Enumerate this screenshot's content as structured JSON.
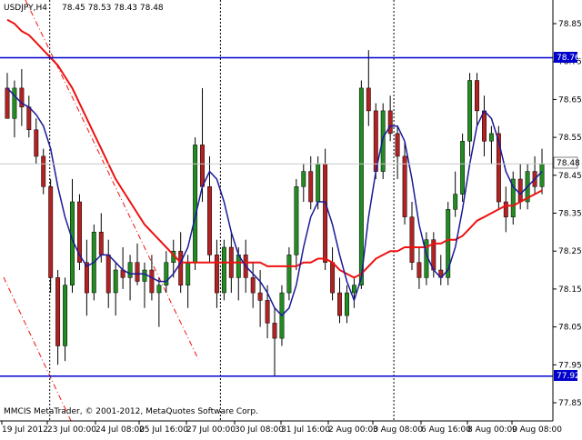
{
  "header": {
    "symbol": "USDJPY,H4",
    "ohlc": "78.45 78.53 78.43 78.48"
  },
  "footer": {
    "copyright": "MMCIS MetaTrader, © 2001-2012, MetaQuotes Software Corp."
  },
  "price_axis": {
    "ticks": [
      "78.85",
      "78.75",
      "78.65",
      "78.55",
      "78.45",
      "78.35",
      "78.25",
      "78.15",
      "78.05",
      "77.95",
      "77.85"
    ],
    "current_price_label": "78.48",
    "upper_line_label": "78.76",
    "lower_line_label": "77.92"
  },
  "time_axis": {
    "ticks": [
      "19 Jul 2012",
      "23 Jul 00:00",
      "24 Jul 08:00",
      "25 Jul 16:00",
      "27 Jul 00:00",
      "30 Jul 08:00",
      "31 Jul 16:00",
      "2 Aug 00:00",
      "3 Aug 08:00",
      "6 Aug 16:00",
      "8 Aug 00:00",
      "9 Aug 08:00"
    ]
  },
  "colors": {
    "bull": "#228b22",
    "bear": "#b22222",
    "wick": "#000000",
    "fast_ma": "#1a1a99",
    "slow_ma": "#ee1111",
    "level_line": "#0000cc",
    "level_label_bg": "#0000cc",
    "price_label_bg": "#ffffff"
  },
  "chart_data": {
    "type": "candlestick",
    "symbol": "USDJPY",
    "timeframe": "H4",
    "y_range": [
      77.8,
      78.9
    ],
    "horizontal_levels": [
      78.76,
      77.92
    ],
    "current_price": 78.48,
    "candles": [
      {
        "o": 78.68,
        "h": 78.72,
        "l": 78.6,
        "c": 78.6
      },
      {
        "o": 78.6,
        "h": 78.7,
        "l": 78.55,
        "c": 78.68
      },
      {
        "o": 78.68,
        "h": 78.73,
        "l": 78.58,
        "c": 78.63
      },
      {
        "o": 78.63,
        "h": 78.66,
        "l": 78.55,
        "c": 78.57
      },
      {
        "o": 78.57,
        "h": 78.6,
        "l": 78.48,
        "c": 78.5
      },
      {
        "o": 78.5,
        "h": 78.52,
        "l": 78.4,
        "c": 78.42
      },
      {
        "o": 78.42,
        "h": 78.44,
        "l": 78.14,
        "c": 78.18
      },
      {
        "o": 78.18,
        "h": 78.2,
        "l": 77.95,
        "c": 78.0
      },
      {
        "o": 78.0,
        "h": 78.18,
        "l": 77.96,
        "c": 78.16
      },
      {
        "o": 78.16,
        "h": 78.44,
        "l": 78.14,
        "c": 78.38
      },
      {
        "o": 78.38,
        "h": 78.4,
        "l": 78.2,
        "c": 78.22
      },
      {
        "o": 78.22,
        "h": 78.28,
        "l": 78.08,
        "c": 78.14
      },
      {
        "o": 78.14,
        "h": 78.32,
        "l": 78.12,
        "c": 78.3
      },
      {
        "o": 78.3,
        "h": 78.35,
        "l": 78.22,
        "c": 78.24
      },
      {
        "o": 78.24,
        "h": 78.28,
        "l": 78.1,
        "c": 78.14
      },
      {
        "o": 78.14,
        "h": 78.22,
        "l": 78.08,
        "c": 78.2
      },
      {
        "o": 78.2,
        "h": 78.26,
        "l": 78.15,
        "c": 78.18
      },
      {
        "o": 78.18,
        "h": 78.24,
        "l": 78.12,
        "c": 78.22
      },
      {
        "o": 78.22,
        "h": 78.27,
        "l": 78.16,
        "c": 78.17
      },
      {
        "o": 78.17,
        "h": 78.22,
        "l": 78.1,
        "c": 78.2
      },
      {
        "o": 78.2,
        "h": 78.24,
        "l": 78.12,
        "c": 78.14
      },
      {
        "o": 78.14,
        "h": 78.18,
        "l": 78.05,
        "c": 78.16
      },
      {
        "o": 78.16,
        "h": 78.25,
        "l": 78.14,
        "c": 78.22
      },
      {
        "o": 78.22,
        "h": 78.28,
        "l": 78.18,
        "c": 78.25
      },
      {
        "o": 78.25,
        "h": 78.3,
        "l": 78.14,
        "c": 78.16
      },
      {
        "o": 78.16,
        "h": 78.24,
        "l": 78.1,
        "c": 78.22
      },
      {
        "o": 78.22,
        "h": 78.55,
        "l": 78.2,
        "c": 78.53
      },
      {
        "o": 78.53,
        "h": 78.68,
        "l": 78.38,
        "c": 78.42
      },
      {
        "o": 78.42,
        "h": 78.5,
        "l": 78.22,
        "c": 78.24
      },
      {
        "o": 78.24,
        "h": 78.28,
        "l": 78.1,
        "c": 78.14
      },
      {
        "o": 78.14,
        "h": 78.28,
        "l": 78.12,
        "c": 78.26
      },
      {
        "o": 78.26,
        "h": 78.3,
        "l": 78.14,
        "c": 78.18
      },
      {
        "o": 78.18,
        "h": 78.26,
        "l": 78.12,
        "c": 78.24
      },
      {
        "o": 78.24,
        "h": 78.28,
        "l": 78.14,
        "c": 78.18
      },
      {
        "o": 78.18,
        "h": 78.22,
        "l": 78.1,
        "c": 78.14
      },
      {
        "o": 78.14,
        "h": 78.2,
        "l": 78.05,
        "c": 78.12
      },
      {
        "o": 78.12,
        "h": 78.16,
        "l": 78.02,
        "c": 78.06
      },
      {
        "o": 78.06,
        "h": 78.1,
        "l": 77.92,
        "c": 78.02
      },
      {
        "o": 78.02,
        "h": 78.16,
        "l": 78.0,
        "c": 78.14
      },
      {
        "o": 78.14,
        "h": 78.26,
        "l": 78.12,
        "c": 78.24
      },
      {
        "o": 78.24,
        "h": 78.44,
        "l": 78.2,
        "c": 78.42
      },
      {
        "o": 78.42,
        "h": 78.48,
        "l": 78.38,
        "c": 78.46
      },
      {
        "o": 78.46,
        "h": 78.5,
        "l": 78.36,
        "c": 78.38
      },
      {
        "o": 78.38,
        "h": 78.5,
        "l": 78.36,
        "c": 78.48
      },
      {
        "o": 78.48,
        "h": 78.52,
        "l": 78.2,
        "c": 78.22
      },
      {
        "o": 78.22,
        "h": 78.26,
        "l": 78.12,
        "c": 78.14
      },
      {
        "o": 78.14,
        "h": 78.18,
        "l": 78.06,
        "c": 78.08
      },
      {
        "o": 78.08,
        "h": 78.16,
        "l": 78.06,
        "c": 78.14
      },
      {
        "o": 78.14,
        "h": 78.18,
        "l": 78.1,
        "c": 78.16
      },
      {
        "o": 78.16,
        "h": 78.7,
        "l": 78.15,
        "c": 78.68
      },
      {
        "o": 78.68,
        "h": 78.78,
        "l": 78.58,
        "c": 78.62
      },
      {
        "o": 78.62,
        "h": 78.64,
        "l": 78.44,
        "c": 78.46
      },
      {
        "o": 78.46,
        "h": 78.64,
        "l": 78.44,
        "c": 78.62
      },
      {
        "o": 78.62,
        "h": 78.66,
        "l": 78.54,
        "c": 78.56
      },
      {
        "o": 78.56,
        "h": 78.58,
        "l": 78.44,
        "c": 78.5
      },
      {
        "o": 78.5,
        "h": 78.54,
        "l": 78.32,
        "c": 78.34
      },
      {
        "o": 78.34,
        "h": 78.38,
        "l": 78.2,
        "c": 78.22
      },
      {
        "o": 78.22,
        "h": 78.26,
        "l": 78.15,
        "c": 78.18
      },
      {
        "o": 78.18,
        "h": 78.3,
        "l": 78.16,
        "c": 78.28
      },
      {
        "o": 78.28,
        "h": 78.3,
        "l": 78.18,
        "c": 78.2
      },
      {
        "o": 78.2,
        "h": 78.24,
        "l": 78.16,
        "c": 78.18
      },
      {
        "o": 78.18,
        "h": 78.38,
        "l": 78.16,
        "c": 78.36
      },
      {
        "o": 78.36,
        "h": 78.46,
        "l": 78.34,
        "c": 78.4
      },
      {
        "o": 78.4,
        "h": 78.56,
        "l": 78.38,
        "c": 78.54
      },
      {
        "o": 78.54,
        "h": 78.72,
        "l": 78.5,
        "c": 78.7
      },
      {
        "o": 78.7,
        "h": 78.72,
        "l": 78.58,
        "c": 78.62
      },
      {
        "o": 78.62,
        "h": 78.66,
        "l": 78.5,
        "c": 78.54
      },
      {
        "o": 78.54,
        "h": 78.58,
        "l": 78.48,
        "c": 78.56
      },
      {
        "o": 78.56,
        "h": 78.58,
        "l": 78.36,
        "c": 78.38
      },
      {
        "o": 78.38,
        "h": 78.42,
        "l": 78.3,
        "c": 78.34
      },
      {
        "o": 78.34,
        "h": 78.46,
        "l": 78.32,
        "c": 78.44
      },
      {
        "o": 78.44,
        "h": 78.48,
        "l": 78.36,
        "c": 78.38
      },
      {
        "o": 78.38,
        "h": 78.48,
        "l": 78.36,
        "c": 78.46
      },
      {
        "o": 78.46,
        "h": 78.5,
        "l": 78.4,
        "c": 78.42
      },
      {
        "o": 78.42,
        "h": 78.52,
        "l": 78.4,
        "c": 78.48
      }
    ],
    "fast_ma": [
      78.68,
      78.66,
      78.64,
      78.63,
      78.61,
      78.58,
      78.52,
      78.42,
      78.34,
      78.28,
      78.24,
      78.21,
      78.22,
      78.24,
      78.24,
      78.22,
      78.2,
      78.19,
      78.19,
      78.19,
      78.18,
      78.17,
      78.17,
      78.19,
      78.22,
      78.26,
      78.34,
      78.42,
      78.46,
      78.44,
      78.38,
      78.3,
      78.24,
      78.21,
      78.19,
      78.17,
      78.14,
      78.1,
      78.08,
      78.1,
      78.16,
      78.26,
      78.34,
      78.38,
      78.38,
      78.32,
      78.24,
      78.17,
      78.12,
      78.18,
      78.34,
      78.46,
      78.55,
      78.58,
      78.58,
      78.54,
      78.44,
      78.32,
      78.24,
      78.2,
      78.18,
      78.2,
      78.26,
      78.36,
      78.48,
      78.58,
      78.62,
      78.6,
      78.54,
      78.46,
      78.42,
      78.4,
      78.42,
      78.44,
      78.46
    ],
    "slow_ma": [
      78.86,
      78.85,
      78.83,
      78.82,
      78.8,
      78.78,
      78.76,
      78.74,
      78.71,
      78.68,
      78.64,
      78.6,
      78.56,
      78.52,
      78.48,
      78.44,
      78.41,
      78.38,
      78.35,
      78.32,
      78.3,
      78.28,
      78.26,
      78.24,
      78.22,
      78.22,
      78.22,
      78.22,
      78.22,
      78.22,
      78.22,
      78.22,
      78.22,
      78.22,
      78.22,
      78.22,
      78.21,
      78.21,
      78.21,
      78.21,
      78.21,
      78.22,
      78.22,
      78.23,
      78.23,
      78.22,
      78.2,
      78.19,
      78.18,
      78.19,
      78.21,
      78.23,
      78.24,
      78.25,
      78.25,
      78.26,
      78.26,
      78.26,
      78.26,
      78.27,
      78.27,
      78.28,
      78.28,
      78.29,
      78.31,
      78.33,
      78.34,
      78.35,
      78.36,
      78.37,
      78.37,
      78.38,
      78.39,
      78.4,
      78.41
    ]
  }
}
